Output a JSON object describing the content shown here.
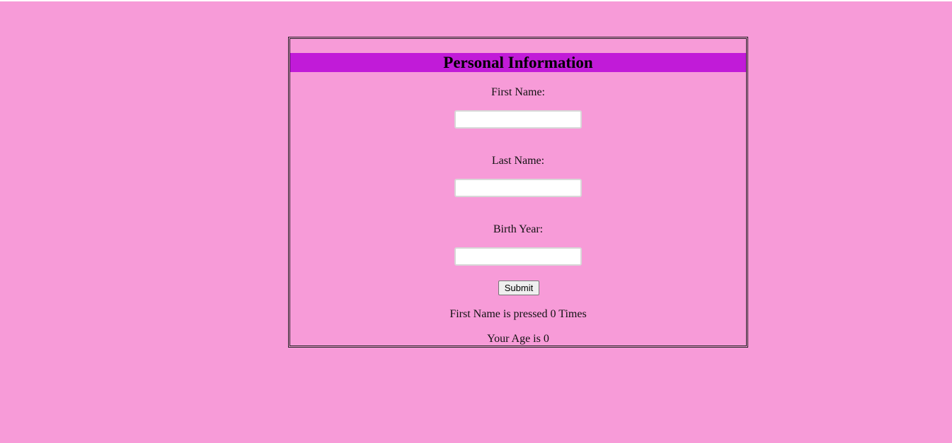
{
  "form": {
    "title": "Personal Information",
    "fields": [
      {
        "label": "First Name:",
        "value": "",
        "placeholder": ""
      },
      {
        "label": "Last Name:",
        "value": "",
        "placeholder": ""
      },
      {
        "label": "Birth Year:",
        "value": "",
        "placeholder": ""
      }
    ],
    "submit_label": "Submit",
    "press_count_text": "First Name is pressed 0 Times",
    "age_text": "Your Age is 0"
  },
  "colors": {
    "background": "#f79bd8",
    "title_bar": "#c11bd8"
  }
}
